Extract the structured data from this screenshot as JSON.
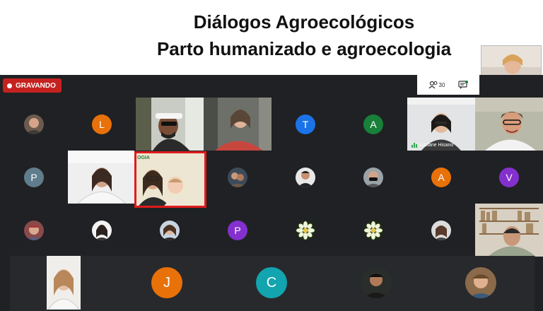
{
  "title": {
    "line1": "Diálogos Agroecológicos",
    "line2": "Parto humanizado e agroecologia"
  },
  "recording": {
    "label": "GRAVANDO",
    "color": "#c5221f"
  },
  "toolbar": {
    "participants_count": "30"
  },
  "participants": {
    "row1": [
      {
        "type": "photo",
        "name": "participant-1"
      },
      {
        "type": "letter",
        "letter": "L",
        "color": "#e8710a"
      },
      {
        "type": "video",
        "name": "man-with-cap"
      },
      {
        "type": "video",
        "name": "woman-red-top"
      },
      {
        "type": "letter",
        "letter": "T",
        "color": "#1a73e8"
      },
      {
        "type": "letter",
        "letter": "A",
        "color": "#188038"
      },
      {
        "type": "video",
        "name": "Luciane Hisano"
      },
      {
        "type": "video",
        "name": "woman-glasses"
      }
    ],
    "row2": [
      {
        "type": "letter",
        "letter": "P",
        "color": "#5f7d8c"
      },
      {
        "type": "video",
        "name": "woman-room"
      },
      {
        "type": "video",
        "name": "mother-and-baby"
      },
      {
        "type": "photo",
        "name": "participant-13"
      },
      {
        "type": "photo",
        "name": "participant-14"
      },
      {
        "type": "photo",
        "name": "participant-15"
      },
      {
        "type": "letter",
        "letter": "A",
        "color": "#e8710a"
      },
      {
        "type": "letter",
        "letter": "V",
        "color": "#8430ce"
      }
    ],
    "row3": [
      {
        "type": "photo",
        "name": "participant-17"
      },
      {
        "type": "photo",
        "name": "participant-18"
      },
      {
        "type": "photo",
        "name": "participant-19"
      },
      {
        "type": "letter",
        "letter": "P",
        "color": "#8430ce"
      },
      {
        "type": "photo",
        "name": "flower-1"
      },
      {
        "type": "photo",
        "name": "flower-2"
      },
      {
        "type": "photo",
        "name": "participant-23"
      },
      {
        "type": "video",
        "name": "man-bookshelf"
      }
    ],
    "row4": [
      {
        "type": "video",
        "name": "woman-blonde"
      },
      {
        "type": "letter",
        "letter": "J",
        "color": "#e8710a"
      },
      {
        "type": "letter",
        "letter": "C",
        "color": "#12a4af"
      },
      {
        "type": "photo",
        "name": "participant-28"
      },
      {
        "type": "photo",
        "name": "participant-29"
      }
    ]
  },
  "labels": {
    "luciane": "Luciane Hisano",
    "ogia": "OGIA"
  }
}
